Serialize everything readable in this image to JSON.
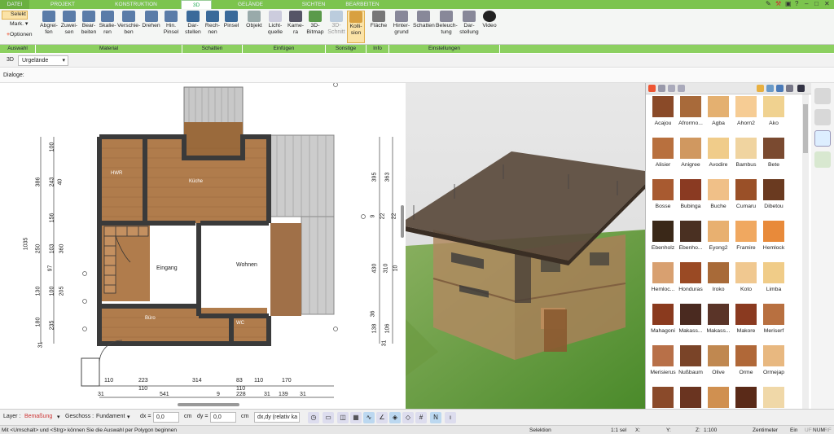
{
  "tabs": {
    "datei": "DATEI",
    "projekt": "PROJEKT",
    "konstruktion": "KONSTRUKTION",
    "d3": "3D",
    "gelaende": "GELÄNDE",
    "sichten": "SICHTEN",
    "bearbeiten": "BEARBEITEN"
  },
  "ribbon": {
    "selekt": "Selekt",
    "mark": "Mark.",
    "optionen": "Optionen",
    "abgreifen": "Abgrei-\nfen",
    "zuweisen": "Zuwei-\nsen",
    "bearbeiten": "Bear-\nbeiten",
    "skalieren": "Skalie-\nren",
    "verschieben": "Verschie-\nben",
    "drehen": "Drehen",
    "hinpinsel": "Hin.\nPinsel",
    "darstellen": "Dar-\nstellen",
    "rechnen": "Rech-\nnen",
    "pinsel": "Pinsel",
    "objekt": "Objekt",
    "lichtquelle": "Licht-\nquelle",
    "kamera": "Kame-\nra",
    "bitmap": "3D-\nBitmap",
    "schnitt": "3D-\nSchnitt",
    "kollision": "Kolli-\nsion",
    "flaeche": "Fläche",
    "hintergrund": "Hinter-\ngrund",
    "schatten": "Schatten",
    "beleuchtung": "Beleuch-\ntung",
    "darstellung": "Dar-\nstellung",
    "video": "Video"
  },
  "groups": {
    "auswahl": "Auswahl",
    "material": "Material",
    "schatten": "Schatten",
    "einfuegen": "Einfügen",
    "sonstige": "Sonstige",
    "info": "Info",
    "einstellungen": "Einstellungen"
  },
  "toolbar3d": {
    "label": "3D",
    "value": "Urgelände"
  },
  "dialoge": "Dialoge:",
  "plan": {
    "rooms": {
      "hwr": "HWR",
      "kueche": "Küche",
      "eingang": "Eingang",
      "wohnen": "Wohnen",
      "buero": "Büro",
      "wc": "WC"
    },
    "left_dims": [
      "100",
      "386",
      "243",
      "40",
      "156",
      "1035",
      "250",
      "103",
      "360",
      "97",
      "130",
      "205",
      "100",
      "180",
      "235",
      "31"
    ],
    "right_dims": [
      "395",
      "363",
      "9",
      "22",
      "22",
      "430",
      "310",
      "10",
      "138",
      "106",
      "36",
      "31"
    ],
    "bottom_row1": [
      "110",
      "223",
      "314",
      "83",
      "110",
      "170"
    ],
    "bottom_row2": [
      "110",
      "110"
    ],
    "bottom_row3": [
      "31",
      "541",
      "9",
      "228",
      "31",
      "139",
      "31"
    ]
  },
  "materials": [
    {
      "name": "Acajou",
      "color": "#8a4a28"
    },
    {
      "name": "Afrormo...",
      "color": "#a86a3a"
    },
    {
      "name": "Agba",
      "color": "#e4b070"
    },
    {
      "name": "Ahorn2",
      "color": "#f6cc94"
    },
    {
      "name": "Ako",
      "color": "#f0d290"
    },
    {
      "name": "Alisier",
      "color": "#b8703e"
    },
    {
      "name": "Anigree",
      "color": "#d09860"
    },
    {
      "name": "Avodire",
      "color": "#f0cc8a"
    },
    {
      "name": "Bambus",
      "color": "#f0d4a0"
    },
    {
      "name": "Bete",
      "color": "#7a4a30"
    },
    {
      "name": "Bosse",
      "color": "#a85a30"
    },
    {
      "name": "Bubinga",
      "color": "#8a3a22"
    },
    {
      "name": "Buche",
      "color": "#f0c088"
    },
    {
      "name": "Cumaru",
      "color": "#9a5028"
    },
    {
      "name": "Dibetou",
      "color": "#6a3a20"
    },
    {
      "name": "Ebenholz",
      "color": "#3a2818"
    },
    {
      "name": "Ebenho...",
      "color": "#4a3022"
    },
    {
      "name": "Eyong2",
      "color": "#e8b070"
    },
    {
      "name": "Framire",
      "color": "#f0a860"
    },
    {
      "name": "Hemlock",
      "color": "#e88a3a"
    },
    {
      "name": "Hemloc...",
      "color": "#d8a070"
    },
    {
      "name": "Honduras",
      "color": "#9a4a24"
    },
    {
      "name": "Iroko",
      "color": "#a86a38"
    },
    {
      "name": "Koto",
      "color": "#f0c890"
    },
    {
      "name": "Limba",
      "color": "#f0cc88"
    },
    {
      "name": "Mahagoni",
      "color": "#8a3a1e"
    },
    {
      "name": "Makass...",
      "color": "#4a2a20"
    },
    {
      "name": "Makass...",
      "color": "#5a3428"
    },
    {
      "name": "Makore",
      "color": "#8a3a20"
    },
    {
      "name": "Meriserf",
      "color": "#b87040"
    },
    {
      "name": "Merisierus",
      "color": "#b87048"
    },
    {
      "name": "Nußbaum",
      "color": "#7a4428"
    },
    {
      "name": "Olive",
      "color": "#c08850"
    },
    {
      "name": "Orme",
      "color": "#b06838"
    },
    {
      "name": "Ormejap",
      "color": "#e8b880"
    },
    {
      "name": "",
      "color": "#8a4a2a"
    },
    {
      "name": "",
      "color": "#6a3420"
    },
    {
      "name": "",
      "color": "#d09050"
    },
    {
      "name": "",
      "color": "#5a2a18"
    },
    {
      "name": "",
      "color": "#f0d8a8"
    }
  ],
  "statusbar": {
    "layer_label": "Layer :",
    "layer_value": "Bemaßung",
    "geschoss_label": "Geschoss :",
    "geschoss_value": "Fundament",
    "dx_label": "dx =",
    "dx_value": "0,0",
    "dx_unit": "cm",
    "dy_label": "dy =",
    "dy_value": "0,0",
    "dy_unit": "cm",
    "mode": "dx,dy (relativ ka"
  },
  "infobar": {
    "hint": "Mit <Umschalt> und <Strg> können Sie die Auswahl per Polygon beginnen",
    "selektion": "Selektion",
    "scale": "1:1 sel",
    "x": "X:",
    "y": "Y:",
    "z": "Z:",
    "ratio": "1:100",
    "unit": "Zentimeter",
    "ein": "Ein",
    "uf": "UF",
    "nf": "NUM",
    "rf": "RF"
  }
}
